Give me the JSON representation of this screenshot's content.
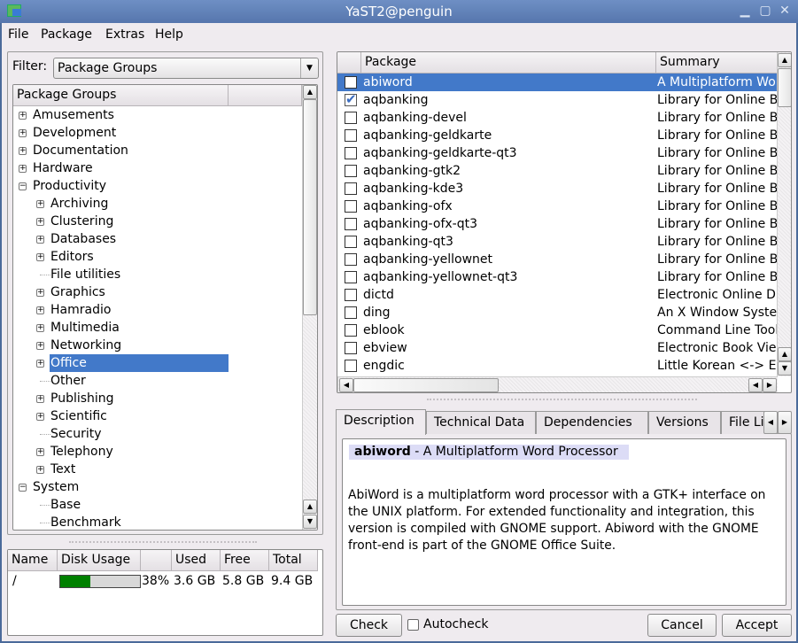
{
  "window": {
    "title": "YaST2@penguin"
  },
  "menu": [
    {
      "label": "File"
    },
    {
      "label": "Package"
    },
    {
      "label": "Extras"
    },
    {
      "label": "Help"
    }
  ],
  "filter": {
    "label": "Filter:",
    "value": "Package Groups"
  },
  "tree": {
    "header": "Package Groups",
    "items": [
      {
        "label": "Amusements",
        "level": 0,
        "expander": "plus"
      },
      {
        "label": "Development",
        "level": 0,
        "expander": "plus"
      },
      {
        "label": "Documentation",
        "level": 0,
        "expander": "plus"
      },
      {
        "label": "Hardware",
        "level": 0,
        "expander": "plus"
      },
      {
        "label": "Productivity",
        "level": 0,
        "expander": "minus"
      },
      {
        "label": "Archiving",
        "level": 1,
        "expander": "plus"
      },
      {
        "label": "Clustering",
        "level": 1,
        "expander": "plus"
      },
      {
        "label": "Databases",
        "level": 1,
        "expander": "plus"
      },
      {
        "label": "Editors",
        "level": 1,
        "expander": "plus"
      },
      {
        "label": "File utilities",
        "level": 1,
        "expander": "none"
      },
      {
        "label": "Graphics",
        "level": 1,
        "expander": "plus"
      },
      {
        "label": "Hamradio",
        "level": 1,
        "expander": "plus"
      },
      {
        "label": "Multimedia",
        "level": 1,
        "expander": "plus"
      },
      {
        "label": "Networking",
        "level": 1,
        "expander": "plus"
      },
      {
        "label": "Office",
        "level": 1,
        "expander": "plus",
        "selected": true
      },
      {
        "label": "Other",
        "level": 1,
        "expander": "none"
      },
      {
        "label": "Publishing",
        "level": 1,
        "expander": "plus"
      },
      {
        "label": "Scientific",
        "level": 1,
        "expander": "plus"
      },
      {
        "label": "Security",
        "level": 1,
        "expander": "none"
      },
      {
        "label": "Telephony",
        "level": 1,
        "expander": "plus"
      },
      {
        "label": "Text",
        "level": 1,
        "expander": "plus"
      },
      {
        "label": "System",
        "level": 0,
        "expander": "minus"
      },
      {
        "label": "Base",
        "level": 1,
        "expander": "none"
      },
      {
        "label": "Benchmark",
        "level": 1,
        "expander": "none"
      }
    ]
  },
  "disk": {
    "columns": [
      "Name",
      "Disk Usage",
      "",
      "Used",
      "Free",
      "Total"
    ],
    "rows": [
      {
        "name": "/",
        "usage_percent": 38,
        "percent_label": "38%",
        "used": "3.6 GB",
        "free": "5.8 GB",
        "total": "9.4 GB"
      }
    ],
    "bar_color": "#008000"
  },
  "packages": {
    "columns": [
      "",
      "Package",
      "Summary"
    ],
    "rows": [
      {
        "name": "abiword",
        "summary": "A Multiplatform Word Processor",
        "checked": false,
        "selected": true
      },
      {
        "name": "aqbanking",
        "summary": "Library for Online Banking",
        "checked": true
      },
      {
        "name": "aqbanking-devel",
        "summary": "Library for Online Banking",
        "checked": false
      },
      {
        "name": "aqbanking-geldkarte",
        "summary": "Library for Online Banking",
        "checked": false
      },
      {
        "name": "aqbanking-geldkarte-qt3",
        "summary": "Library for Online Banking",
        "checked": false
      },
      {
        "name": "aqbanking-gtk2",
        "summary": "Library for Online Banking",
        "checked": false
      },
      {
        "name": "aqbanking-kde3",
        "summary": "Library for Online Banking",
        "checked": false
      },
      {
        "name": "aqbanking-ofx",
        "summary": "Library for Online Banking",
        "checked": false
      },
      {
        "name": "aqbanking-ofx-qt3",
        "summary": "Library for Online Banking",
        "checked": false
      },
      {
        "name": "aqbanking-qt3",
        "summary": "Library for Online Banking",
        "checked": false
      },
      {
        "name": "aqbanking-yellownet",
        "summary": "Library for Online Banking",
        "checked": false
      },
      {
        "name": "aqbanking-yellownet-qt3",
        "summary": "Library for Online Banking",
        "checked": false
      },
      {
        "name": "dictd",
        "summary": "Electronic Online Dictionary",
        "checked": false
      },
      {
        "name": "ding",
        "summary": "An X Window System",
        "checked": false
      },
      {
        "name": "eblook",
        "summary": "Command Line Tool",
        "checked": false
      },
      {
        "name": "ebview",
        "summary": "Electronic Book Viewer",
        "checked": false
      },
      {
        "name": "engdic",
        "summary": "Little Korean <-> English",
        "checked": false
      }
    ]
  },
  "tabs": [
    {
      "label": "Description",
      "active": true
    },
    {
      "label": "Technical Data"
    },
    {
      "label": "Dependencies"
    },
    {
      "label": "Versions"
    },
    {
      "label": "File List"
    }
  ],
  "description": {
    "name": "abiword",
    "summary": " - A Multiplatform Word Processor",
    "body": "AbiWord is a multiplatform word processor with a GTK+ interface on the UNIX platform. For extended functionality and integration, this version is compiled with GNOME support. Abiword with the GNOME front-end is part of the GNOME Office Suite."
  },
  "buttons": {
    "check": "Check",
    "autocheck": "Autocheck",
    "cancel": "Cancel",
    "accept": "Accept"
  },
  "colors": {
    "selection": "#4279c9",
    "titlebar": "#5676ad",
    "desc_highlight": "#dcdcf6"
  }
}
